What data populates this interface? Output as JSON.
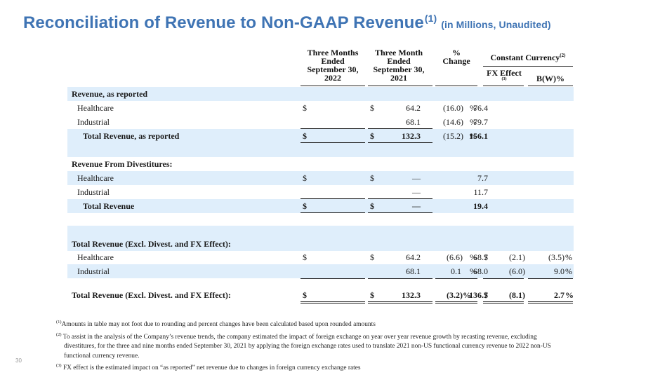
{
  "title": {
    "main": "Reconciliation of Revenue to Non-GAAP Revenue",
    "sup": "(1)",
    "sub": "(in Millions, Unaudited)"
  },
  "headers": {
    "col1": [
      "Three Months",
      "Ended",
      "September 30,",
      "2022"
    ],
    "col2": [
      "Three Month",
      "Ended",
      "September 30,",
      "2021"
    ],
    "col3": [
      "%",
      "Change"
    ],
    "cc_label": "Constant Currency",
    "cc_sup": "(2)",
    "fx_label": "FX Effect",
    "fx_sup": "(3)",
    "bw_label": "B(W)%"
  },
  "sections": [
    {
      "id": "reported",
      "rows": [
        {
          "label": "Revenue, as reported",
          "bold": true,
          "indent": 0
        },
        {
          "label": "Healthcare",
          "indent": 1,
          "c1": "$",
          "v1": "64.2",
          "c2": "$",
          "v2": "76.4",
          "pct": "(16.0)",
          "pctsign": "%"
        },
        {
          "label": "Industrial",
          "indent": 1,
          "v1": "68.1",
          "v2": "79.7",
          "pct": "(14.6)",
          "pctsign": "%"
        },
        {
          "label": "Total Revenue, as reported",
          "bold": true,
          "indent": 2,
          "c1": "$",
          "v1": "132.3",
          "c2": "$",
          "v2": "156.1",
          "pct": "(15.2)",
          "pctsign": "%"
        }
      ]
    },
    {
      "id": "divest",
      "rows": [
        {
          "label": "Revenue From Divestitures:",
          "bold": true,
          "indent": 0
        },
        {
          "label": "Healthcare",
          "indent": 1,
          "c1": "$",
          "v1": "—",
          "c2": "$",
          "v2": "7.7"
        },
        {
          "label": "Industrial",
          "indent": 1,
          "v1": "—",
          "v2": "11.7"
        },
        {
          "label": "Total Revenue",
          "bold": true,
          "indent": 2,
          "c1": "$",
          "v1": "—",
          "c2": "$",
          "v2": "19.4"
        }
      ]
    },
    {
      "id": "excl",
      "rows": [
        {
          "label": "Total Revenue (Excl.  Divest. and FX Effect):",
          "bold": true,
          "indent": 0
        },
        {
          "label": "Healthcare",
          "indent": 1,
          "c1": "$",
          "v1": "64.2",
          "c2": "$",
          "v2": "68.7",
          "pct": "(6.6)",
          "pctsign": "%",
          "c3": "$",
          "fx": "(2.1)",
          "bw": "(3.5)",
          "bwsign": "%"
        },
        {
          "label": "Industrial",
          "indent": 1,
          "v1": "68.1",
          "v2": "68.0",
          "pct": "0.1",
          "pctsign": "%",
          "fx": "(6.0)",
          "bw": "9.0",
          "bwsign": "%"
        }
      ]
    },
    {
      "id": "grand",
      "rows": [
        {
          "label": "Total Revenue (Excl.  Divest. and FX Effect):",
          "bold": true,
          "indent": 0,
          "c1": "$",
          "v1": "132.3",
          "c2": "$",
          "v2": "136.7",
          "pct": "(3.2)%",
          "c3": "$",
          "fx": "(8.1)",
          "bw": "2.7",
          "bwsign": "%"
        }
      ]
    }
  ],
  "footnotes": {
    "n1_sup": "(1)",
    "n1": "Amounts in table may not foot due to rounding and percent changes have been calculated based upon rounded amounts",
    "n2_sup": "(2)",
    "n2a": " To assist in the analysis of the Company’s revenue trends, the company estimated the impact of foreign exchange on year over year revenue growth by recasting revenue, excluding",
    "n2b": "divestitures, for the three and nine months ended September 30, 2021 by applying the foreign exchange rates used to translate 2021 non-US functional currency revenue to 2022 non-US",
    "n2c": "functional currency revenue.",
    "n3_sup": "(3)",
    "n3": " FX effect is the estimated impact on “as reported” net revenue due to changes in foreign currency exchange rates"
  },
  "page_number": "30"
}
